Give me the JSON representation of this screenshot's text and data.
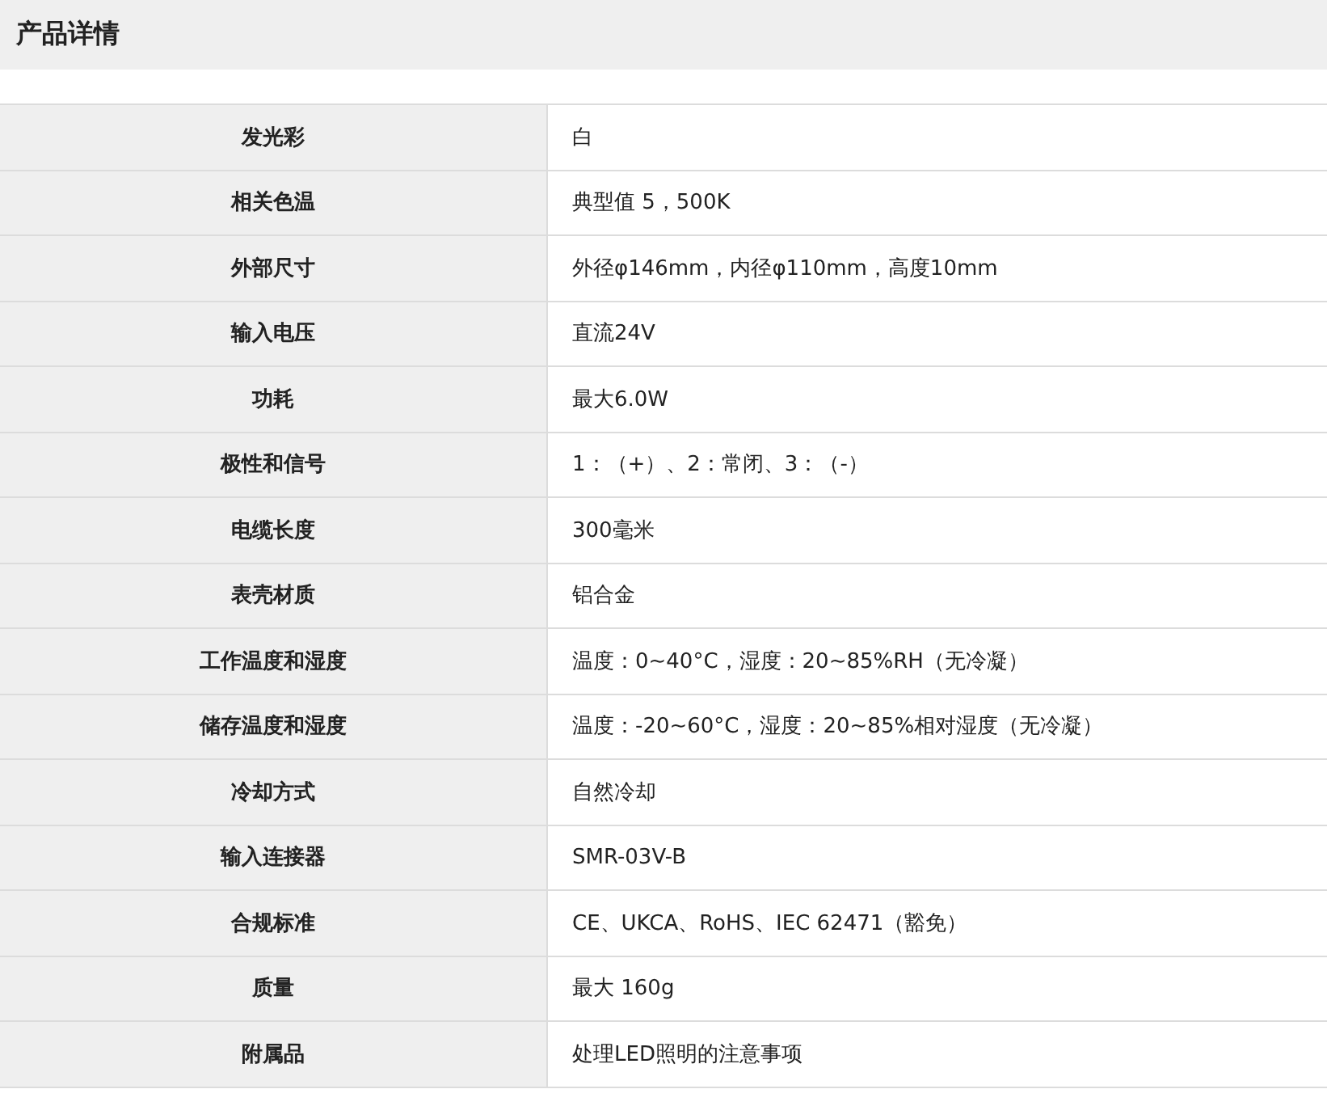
{
  "section": {
    "title": "产品详情"
  },
  "specs": [
    {
      "label": "发光彩",
      "value": "白"
    },
    {
      "label": "相关色温",
      "value": "典型值 5，500K"
    },
    {
      "label": "外部尺寸",
      "value": "外径φ146mm，内径φ110mm，高度10mm"
    },
    {
      "label": "输入电压",
      "value": "直流24V"
    },
    {
      "label": "功耗",
      "value": "最大6.0W"
    },
    {
      "label": "极性和信号",
      "value": "1：（+）、2：常闭、3：（-）"
    },
    {
      "label": "电缆长度",
      "value": "300毫米"
    },
    {
      "label": "表壳材质",
      "value": "铝合金"
    },
    {
      "label": "工作温度和湿度",
      "value": "温度：0~40°C，湿度：20~85%RH（无冷凝）"
    },
    {
      "label": "储存温度和湿度",
      "value": "温度：-20~60°C，湿度：20~85%相对湿度（无冷凝）"
    },
    {
      "label": "冷却方式",
      "value": "自然冷却"
    },
    {
      "label": "输入连接器",
      "value": "SMR-03V-B"
    },
    {
      "label": "合规标准",
      "value": "CE、UKCA、RoHS、IEC 62471（豁免）"
    },
    {
      "label": "质量",
      "value": "最大 160g"
    },
    {
      "label": "附属品",
      "value": "处理LED照明的注意事项"
    }
  ]
}
